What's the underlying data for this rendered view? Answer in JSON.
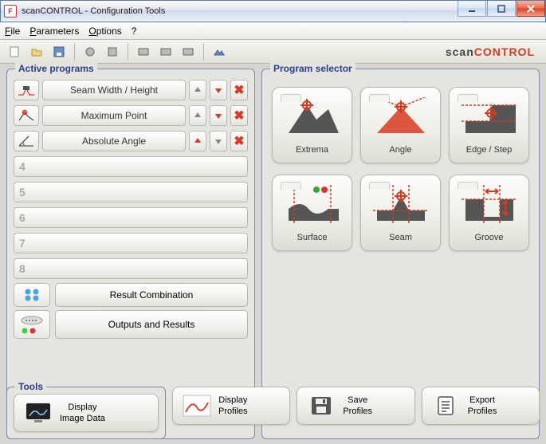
{
  "window": {
    "title": "scanCONTROL - Configuration Tools"
  },
  "menu": {
    "file": "File",
    "parameters": "Parameters",
    "options": "Options",
    "help": "?"
  },
  "brand": {
    "part1": "scan",
    "part2": "CONTROL"
  },
  "active": {
    "legend": "Active programs",
    "items": [
      {
        "label": "Seam Width / Height",
        "downActive": true
      },
      {
        "label": "Maximum Point",
        "downActive": true
      },
      {
        "label": "Absolute Angle",
        "downActive": true
      }
    ],
    "emptySlots": [
      "4",
      "5",
      "6",
      "7",
      "8"
    ],
    "resultCombination": "Result Combination",
    "outputsResults": "Outputs and Results"
  },
  "selector": {
    "legend": "Program selector",
    "items": [
      {
        "label": "Extrema"
      },
      {
        "label": "Angle"
      },
      {
        "label": "Edge / Step"
      },
      {
        "label": "Surface"
      },
      {
        "label": "Seam"
      },
      {
        "label": "Groove"
      }
    ]
  },
  "tools": {
    "legend": "Tools",
    "displayImage": "Display\nImage Data",
    "displayProfiles": "Display\nProfiles",
    "saveProfiles": "Save\nProfiles",
    "exportProfiles": "Export\nProfiles"
  }
}
